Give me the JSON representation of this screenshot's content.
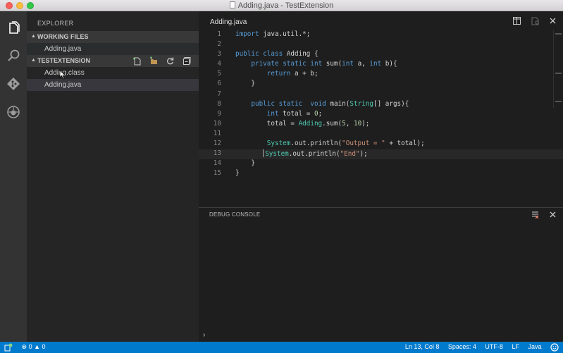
{
  "window": {
    "title": "Adding.java - TestExtension"
  },
  "activity_bar": {
    "items": [
      {
        "icon": "files-icon"
      },
      {
        "icon": "search-icon"
      },
      {
        "icon": "git-icon"
      },
      {
        "icon": "debug-icon"
      }
    ]
  },
  "sidebar": {
    "title": "EXPLORER",
    "working_files": {
      "label": "WORKING FILES",
      "items": [
        "Adding.java"
      ]
    },
    "project": {
      "label": "TESTEXTENSION",
      "icons": [
        "new-file-icon",
        "new-folder-icon",
        "refresh-icon",
        "collapse-all-icon"
      ],
      "items": [
        "Adding.class",
        "Adding.java"
      ]
    }
  },
  "editor": {
    "tab_label": "Adding.java",
    "actions": [
      "split-editor-icon",
      "open-changes-icon",
      "close-icon"
    ],
    "active_line": 13,
    "lines": [
      {
        "n": "1",
        "text": "import java.util.*;"
      },
      {
        "n": "2",
        "text": ""
      },
      {
        "n": "3",
        "text": "public class Adding {"
      },
      {
        "n": "4",
        "text": "    private static int sum(int a, int b){"
      },
      {
        "n": "5",
        "text": "        return a + b;"
      },
      {
        "n": "6",
        "text": "    }"
      },
      {
        "n": "7",
        "text": ""
      },
      {
        "n": "8",
        "text": "    public static  void main(String[] args){"
      },
      {
        "n": "9",
        "text": "        int total = 0;"
      },
      {
        "n": "10",
        "text": "        total = Adding.sum(5, 10);"
      },
      {
        "n": "11",
        "text": ""
      },
      {
        "n": "12",
        "text": "        System.out.println(\"Output = \" + total);"
      },
      {
        "n": "13",
        "text": "        System.out.println(\"End\");"
      },
      {
        "n": "14",
        "text": "    }"
      },
      {
        "n": "15",
        "text": "}"
      }
    ]
  },
  "debug_console": {
    "title": "DEBUG CONSOLE",
    "actions": [
      "clear-console-icon",
      "close-icon"
    ],
    "prompt": "›"
  },
  "status_bar": {
    "errors": "0",
    "warnings": "0",
    "position": "Ln 13, Col 8",
    "spaces": "Spaces: 4",
    "encoding": "UTF-8",
    "eol": "LF",
    "language": "Java"
  },
  "colors": {
    "status_bar": "#007acc",
    "keyword": "#569cd6",
    "type": "#4ec9b0",
    "string": "#ce9178",
    "number": "#b5cea8"
  }
}
